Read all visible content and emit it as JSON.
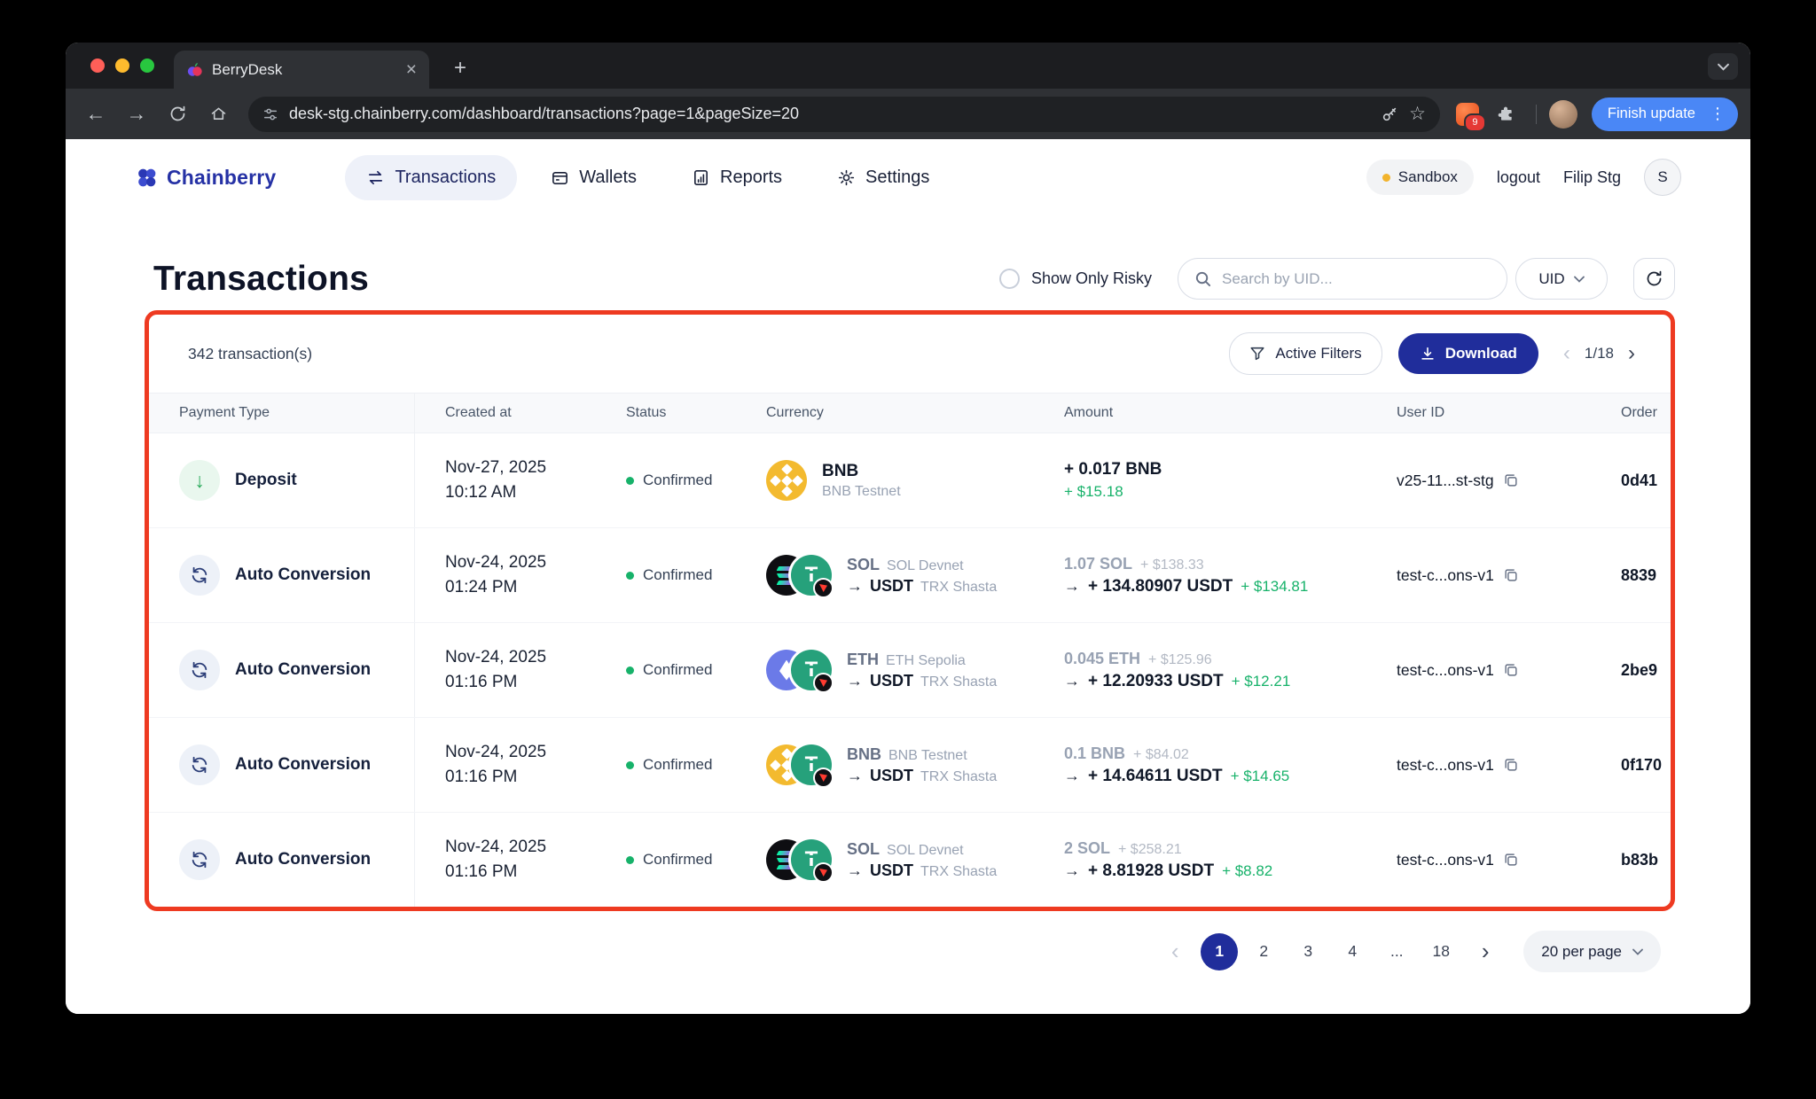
{
  "colors": {
    "brand": "#2531a5",
    "accent_navy": "#202d9b",
    "success_green": "#17b26a",
    "annotation_red": "#ee3a21",
    "sandbox_dot": "#f2b32c",
    "update_blue": "#4a87f6",
    "bnb_yellow": "#f3ba2f",
    "usdt_teal": "#26a17b",
    "eth_indigo": "#6b7ae8"
  },
  "icons": {
    "back": "←",
    "forward": "→",
    "close": "×",
    "new_tab": "+",
    "menu_dots": "⋮",
    "star": "☆",
    "deposit_arrow": "↓",
    "prev": "‹",
    "next": "›",
    "usdt_symbol": "T"
  },
  "browser": {
    "tab_title": "BerryDesk",
    "url": "desk-stg.chainberry.com/dashboard/transactions?page=1&pageSize=20",
    "extension_badge": "9",
    "update_button": "Finish update"
  },
  "header": {
    "brand": "Chainberry",
    "nav": [
      {
        "label": "Transactions"
      },
      {
        "label": "Wallets"
      },
      {
        "label": "Reports"
      },
      {
        "label": "Settings"
      }
    ],
    "env_badge": "Sandbox",
    "logout_label": "logout",
    "user_name": "Filip Stg",
    "avatar_initial": "S"
  },
  "page": {
    "title": "Transactions",
    "risky_label": "Show Only Risky",
    "search_placeholder": "Search by UID...",
    "search_field": "UID"
  },
  "table": {
    "count": "342 transaction(s)",
    "filters_label": "Active Filters",
    "download_label": "Download",
    "page_indicator": "1/18",
    "arrow": "→",
    "columns": [
      "Payment Type",
      "Created at",
      "Status",
      "Currency",
      "Amount",
      "User ID",
      "Order"
    ],
    "rows": [
      {
        "type": "Deposit",
        "date": "Nov-27, 2025",
        "time": "10:12 AM",
        "status": "Confirmed",
        "coin": "BNB",
        "network": "BNB Testnet",
        "amount": "+ 0.017 BNB",
        "amount_usd": "+ $15.18",
        "user_id": "v25-11...st-stg",
        "order_id": "0d41"
      },
      {
        "type": "Auto Conversion",
        "date": "Nov-24, 2025",
        "time": "01:24 PM",
        "status": "Confirmed",
        "from_coin": "SOL",
        "from_network": "SOL Devnet",
        "to_coin": "USDT",
        "to_network": "TRX Shasta",
        "from_amount": "1.07 SOL",
        "from_usd": "+ $138.33",
        "to_amount": "+ 134.80907 USDT",
        "to_usd": "+ $134.81",
        "user_id": "test-c...ons-v1",
        "order_id": "8839"
      },
      {
        "type": "Auto Conversion",
        "date": "Nov-24, 2025",
        "time": "01:16 PM",
        "status": "Confirmed",
        "from_coin": "ETH",
        "from_network": "ETH Sepolia",
        "to_coin": "USDT",
        "to_network": "TRX Shasta",
        "from_amount": "0.045 ETH",
        "from_usd": "+ $125.96",
        "to_amount": "+ 12.20933 USDT",
        "to_usd": "+ $12.21",
        "user_id": "test-c...ons-v1",
        "order_id": "2be9"
      },
      {
        "type": "Auto Conversion",
        "date": "Nov-24, 2025",
        "time": "01:16 PM",
        "status": "Confirmed",
        "from_coin": "BNB",
        "from_network": "BNB Testnet",
        "to_coin": "USDT",
        "to_network": "TRX Shasta",
        "from_amount": "0.1 BNB",
        "from_usd": "+ $84.02",
        "to_amount": "+ 14.64611 USDT",
        "to_usd": "+ $14.65",
        "user_id": "test-c...ons-v1",
        "order_id": "0f170"
      },
      {
        "type": "Auto Conversion",
        "date": "Nov-24, 2025",
        "time": "01:16 PM",
        "status": "Confirmed",
        "from_coin": "SOL",
        "from_network": "SOL Devnet",
        "to_coin": "USDT",
        "to_network": "TRX Shasta",
        "from_amount": "2 SOL",
        "from_usd": "+ $258.21",
        "to_amount": "+ 8.81928 USDT",
        "to_usd": "+ $8.82",
        "user_id": "test-c...ons-v1",
        "order_id": "b83b"
      }
    ]
  },
  "pagination": {
    "items": [
      "1",
      "2",
      "3",
      "4",
      "...",
      "18"
    ],
    "per_page": "20 per page"
  }
}
